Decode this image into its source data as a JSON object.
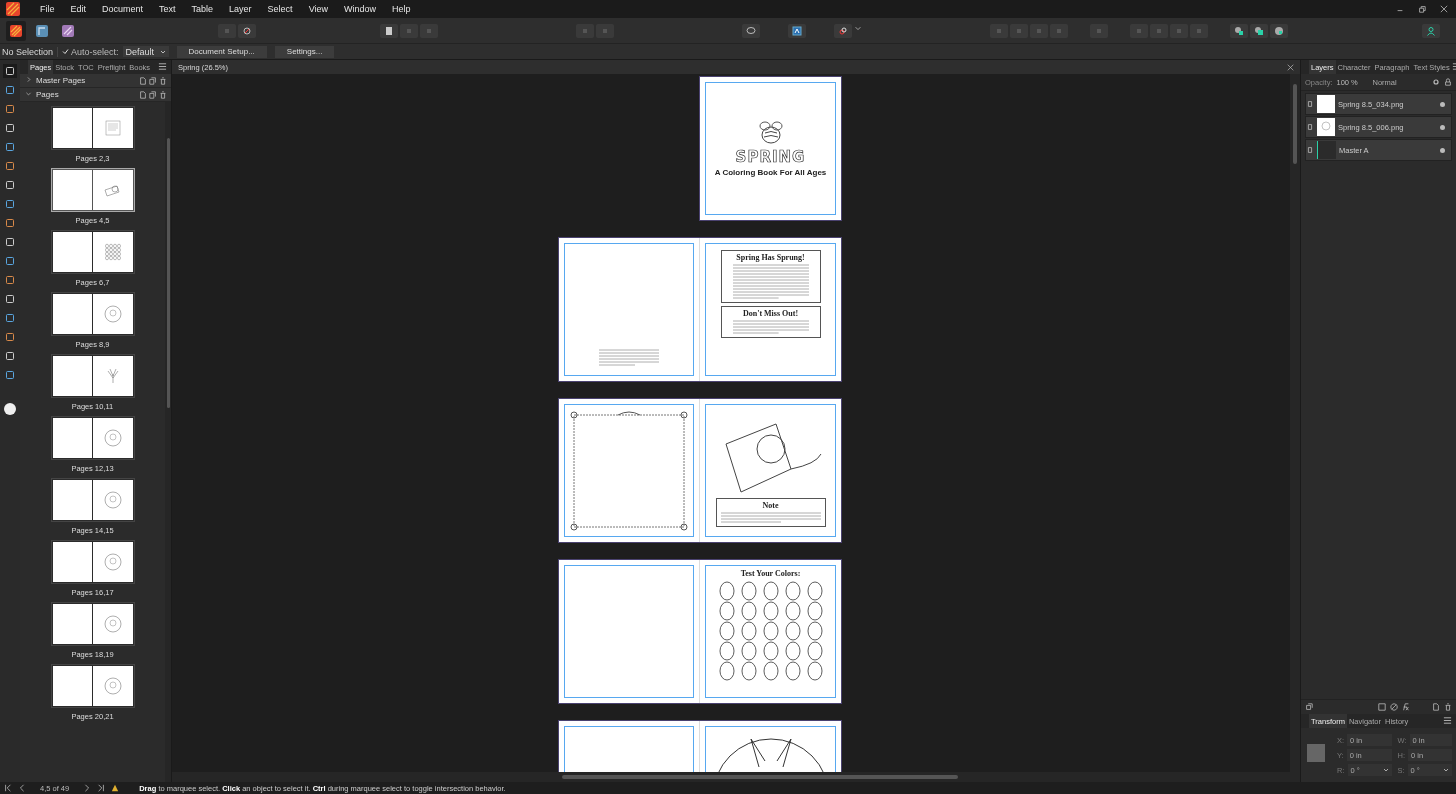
{
  "menu": [
    "File",
    "Edit",
    "Document",
    "Text",
    "Table",
    "Layer",
    "Select",
    "View",
    "Window",
    "Help"
  ],
  "app_switcher": [
    {
      "kind": "publisher",
      "selected": true
    },
    {
      "kind": "designer",
      "selected": false
    },
    {
      "kind": "photo",
      "selected": false
    }
  ],
  "context_bar": {
    "selection": "No Selection",
    "auto_select": {
      "label": "Auto-select:",
      "checked": true
    },
    "mode": "Default",
    "buttons": [
      "Document Setup...",
      "Settings..."
    ]
  },
  "pages_panel": {
    "tabs": [
      {
        "label": "Pages",
        "selected": true
      },
      {
        "label": "Stock",
        "selected": false
      },
      {
        "label": "TOC",
        "selected": false
      },
      {
        "label": "Preflight",
        "selected": false
      },
      {
        "label": "Books",
        "selected": false
      }
    ],
    "sections": [
      {
        "label": "Master Pages",
        "expanded": false
      },
      {
        "label": "Pages",
        "expanded": true
      }
    ],
    "spreads": [
      {
        "label": "Pages 2,3",
        "selected": false,
        "kind": "text"
      },
      {
        "label": "Pages 4,5",
        "selected": true,
        "kind": "frame"
      },
      {
        "label": "Pages 6,7",
        "selected": false,
        "kind": "eggs"
      },
      {
        "label": "Pages 8,9",
        "selected": false,
        "kind": "circle"
      },
      {
        "label": "Pages 10,11",
        "selected": false,
        "kind": "plant"
      },
      {
        "label": "Pages 12,13",
        "selected": false,
        "kind": "circle"
      },
      {
        "label": "Pages 14,15",
        "selected": false,
        "kind": "circle"
      },
      {
        "label": "Pages 16,17",
        "selected": false,
        "kind": "circle"
      },
      {
        "label": "Pages 18,19",
        "selected": false,
        "kind": "circle"
      },
      {
        "label": "Pages 20,21",
        "selected": false,
        "kind": "circle"
      }
    ]
  },
  "document": {
    "tab": "Spring (26.5%)",
    "spreads": [
      {
        "kind": "cover",
        "title": "SPRING",
        "subtitle": "A Coloring Book For All Ages"
      },
      {
        "kind": "intro",
        "heading": "Spring Has Sprung!",
        "box_heading": "Don't Miss Out!"
      },
      {
        "kind": "note",
        "heading": "Note"
      },
      {
        "kind": "colors",
        "heading": "Test Your Colors:"
      },
      {
        "kind": "bunny"
      }
    ]
  },
  "layers_panel": {
    "tabs": [
      {
        "label": "Layers",
        "selected": true
      },
      {
        "label": "Character",
        "selected": false
      },
      {
        "label": "Paragraph",
        "selected": false
      },
      {
        "label": "Text Styles",
        "selected": false
      }
    ],
    "opacity_label": "Opacity:",
    "opacity": "100 %",
    "blend_mode": "Normal",
    "layers": [
      {
        "name": "Spring 8.5_034.png",
        "kind": "blank"
      },
      {
        "name": "Spring 8.5_006.png",
        "kind": "art"
      },
      {
        "name": "Master A",
        "kind": "master"
      }
    ]
  },
  "transform_panel": {
    "tabs": [
      {
        "label": "Transform",
        "selected": true
      },
      {
        "label": "Navigator",
        "selected": false
      },
      {
        "label": "History",
        "selected": false
      }
    ],
    "fields": [
      {
        "label": "X:",
        "value": "0 in"
      },
      {
        "label": "W:",
        "value": "0 in"
      },
      {
        "label": "Y:",
        "value": "0 in"
      },
      {
        "label": "H:",
        "value": "0 in"
      },
      {
        "label": "R:",
        "value": "0 °",
        "kind": "dropdown"
      },
      {
        "label": "S:",
        "value": "0 °",
        "kind": "dropdown"
      }
    ]
  },
  "status_bar": {
    "page": "4,5 of 49",
    "hint": "**Drag** to marquee select. **Click** an object to select it. **Ctrl** during marquee select to toggle intersection behavior."
  }
}
